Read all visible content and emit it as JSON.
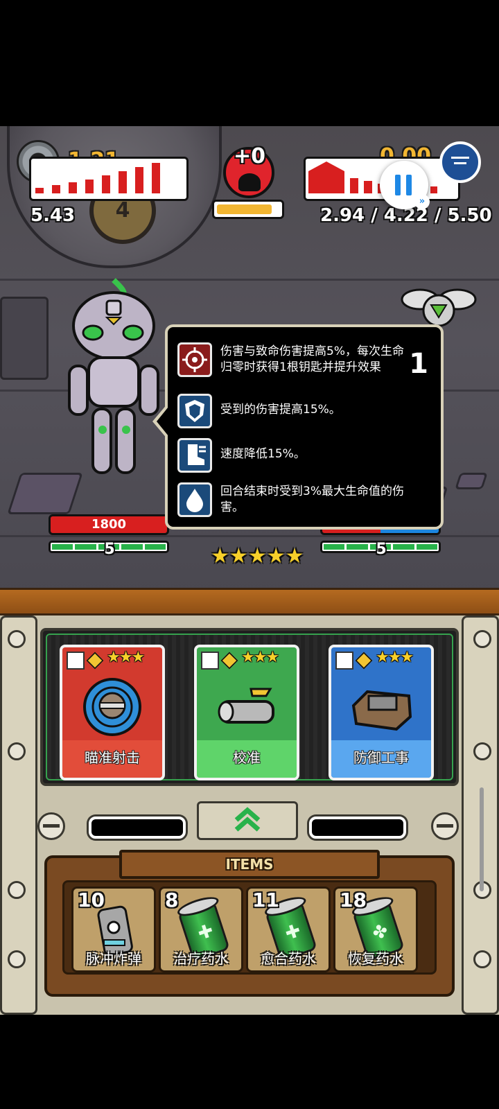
{
  "hud": {
    "left_multiplier": "1.21",
    "left_value": "5.43",
    "machine_level": "4",
    "skull_count": "+0",
    "right_multiplier": "0.00",
    "right_values": "2.94 / 4.22 / 5.50",
    "meter_fill_fraction": 0.88
  },
  "units": {
    "left": {
      "hp": "1800",
      "level": "5"
    },
    "center": {
      "stars": 5
    },
    "right": {
      "level": "5"
    }
  },
  "tooltip": {
    "stack_count": "1",
    "effects": [
      {
        "icon": "crosshair-icon",
        "text": "伤害与致命伤害提高5%，每次生命归零时获得1根钥匙并提升效果",
        "color": "#8a1c1c"
      },
      {
        "icon": "shield-icon",
        "text": "受到的伤害提高15%。",
        "color": "#1b4a7a"
      },
      {
        "icon": "boot-icon",
        "text": "速度降低15%。",
        "color": "#1b4a7a"
      },
      {
        "icon": "drop-icon",
        "text": "回合结束时受到3%最大生命值的伤害。",
        "color": "#1b4a7a"
      }
    ]
  },
  "cards": [
    {
      "label": "瞄准射击",
      "color": "#d23a2e",
      "label_color": "#e24d3a",
      "stars": "★★★"
    },
    {
      "label": "校准",
      "color": "#3ea84f",
      "label_color": "#5fd46a",
      "stars": "★★★"
    },
    {
      "label": "防御工事",
      "color": "#2f73c9",
      "label_color": "#5aa7ef",
      "stars": "★★★"
    }
  ],
  "items": {
    "title": "ITEMS",
    "list": [
      {
        "count": "10",
        "name": "脉冲炸弹"
      },
      {
        "count": "8",
        "name": "治疗药水"
      },
      {
        "count": "11",
        "name": "愈合药水"
      },
      {
        "count": "18",
        "name": "恢复药水"
      }
    ]
  },
  "colors": {
    "hp_red": "#d81f1f",
    "hp_blue": "#1c86e0",
    "gold": "#f2b632"
  }
}
